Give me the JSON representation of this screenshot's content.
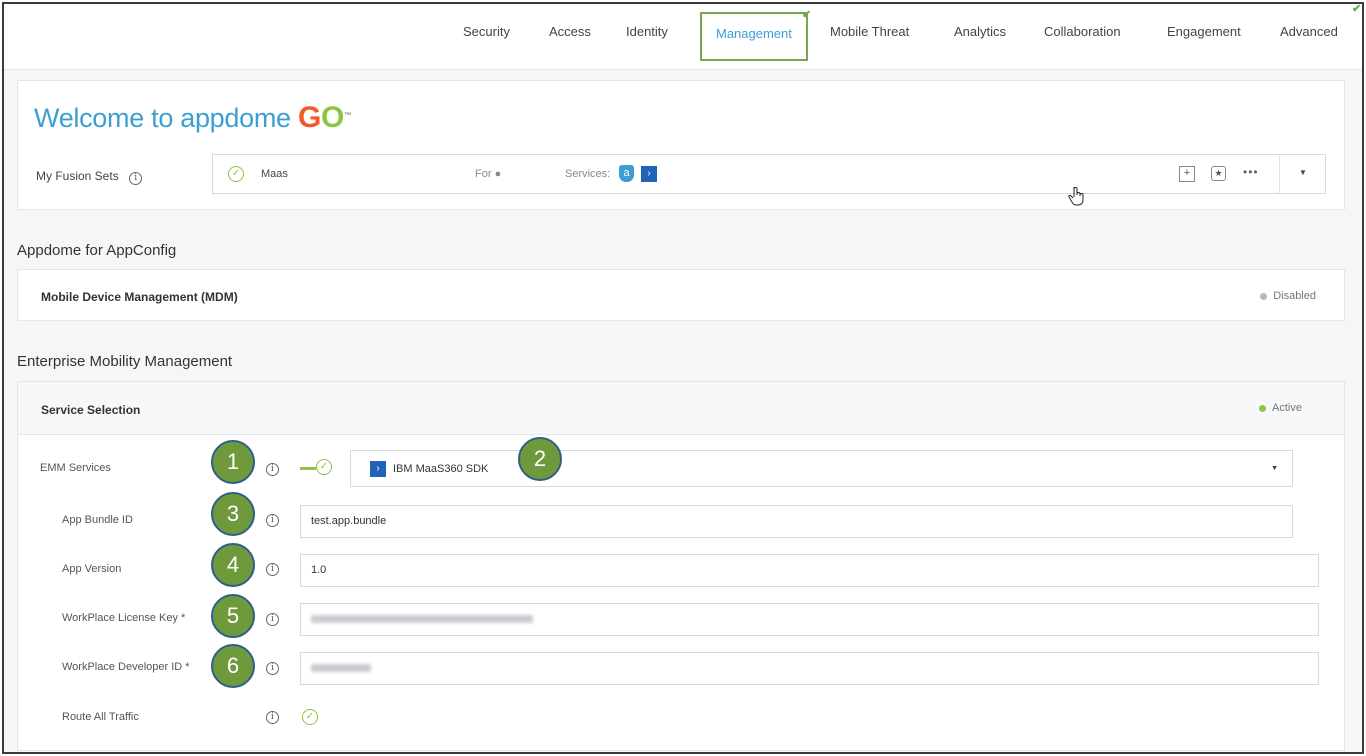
{
  "nav": {
    "tabs": [
      {
        "label": "Security"
      },
      {
        "label": "Access"
      },
      {
        "label": "Identity"
      },
      {
        "label": "Management"
      },
      {
        "label": "Mobile Threat"
      },
      {
        "label": "Analytics"
      },
      {
        "label": "Collaboration"
      },
      {
        "label": "Engagement"
      },
      {
        "label": "Advanced"
      }
    ],
    "active_tab": "Management",
    "accent_color": "#7aa649"
  },
  "welcome": {
    "text": "Welcome to appdome",
    "logo_text": "GO",
    "logo_tm": "™"
  },
  "fusion_sets": {
    "label": "My Fusion Sets",
    "set_name": "Maas",
    "for_label": "For",
    "platform_icon": "apple-icon",
    "services_label": "Services:"
  },
  "appconfig": {
    "section_title": "Appdome for AppConfig",
    "mdm_title": "Mobile Device Management (MDM)",
    "mdm_status": "Disabled"
  },
  "emm": {
    "section_title": "Enterprise Mobility Management",
    "service_selection_title": "Service Selection",
    "service_status": "Active",
    "fields": {
      "emm_services_label": "EMM Services",
      "emm_services_value": "IBM MaaS360 SDK",
      "bundle_label": "App Bundle ID",
      "bundle_value": "test.app.bundle",
      "version_label": "App Version",
      "version_value": "1.0",
      "license_label": "WorkPlace License Key",
      "developer_label": "WorkPlace Developer ID",
      "required_mark": "*",
      "route_label": "Route All Traffic"
    },
    "callouts": [
      "1",
      "2",
      "3",
      "4",
      "5",
      "6"
    ]
  }
}
